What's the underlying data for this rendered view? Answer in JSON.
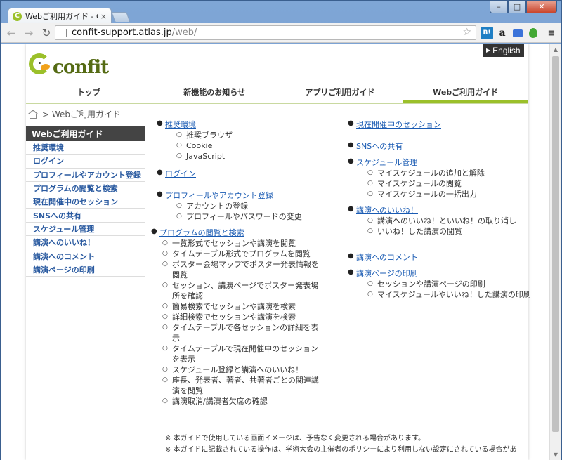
{
  "browser": {
    "tab_title": "Webご利用ガイド - Conf",
    "tab_favicon": "C",
    "tab_close": "×",
    "url_host": "confit-support.atlas.jp",
    "url_path": "/web/",
    "ext_hatena": "B!",
    "ext_amazon": "a",
    "window_min": "–",
    "window_max": "□",
    "window_close": "✕"
  },
  "header": {
    "english_label": "English",
    "logo_text": "confit"
  },
  "nav": {
    "items": [
      "トップ",
      "新機能のお知らせ",
      "アプリご利用ガイド",
      "Webご利用ガイド"
    ]
  },
  "breadcrumb": {
    "separator": ">",
    "current": "Webご利用ガイド"
  },
  "sidebar": {
    "title": "Webご利用ガイド",
    "items": [
      "推奨環境",
      "ログイン",
      "プロフィールやアカウント登録",
      "プログラムの閲覧と検索",
      "現在開催中のセッション",
      "SNSへの共有",
      "スケジュール管理",
      "講演へのいいね！",
      "講演へのコメント",
      "講演ページの印刷"
    ]
  },
  "content": {
    "col1": [
      {
        "title": "推奨環境",
        "items": [
          "推奨ブラウザ",
          "Cookie",
          "JavaScript"
        ]
      },
      {
        "title": "ログイン",
        "items": []
      },
      {
        "title": "プロフィールやアカウント登録",
        "items": [
          "アカウントの登録",
          "プロフィールやパスワードの変更"
        ]
      },
      {
        "title": "プログラムの閲覧と検索",
        "items": [
          "一覧形式でセッションや講演を閲覧",
          "タイムテーブル形式でプログラムを閲覧",
          "ポスター会場マップでポスター発表情報を閲覧",
          "セッション、講演ページでポスター発表場所を確認",
          "簡易検索でセッションや講演を検索",
          "詳細検索でセッションや講演を検索",
          "タイムテーブルで各セッションの詳細を表示",
          "タイムテーブルで現在開催中のセッションを表示",
          "スケジュール登録と講演へのいいね！",
          "座長、発表者、著者、共著者ごとの関連講演を閲覧",
          "講演取消/講演者欠席の確認"
        ]
      }
    ],
    "col2": [
      {
        "title": "現在開催中のセッション",
        "items": []
      },
      {
        "title": "SNSへの共有",
        "items": []
      },
      {
        "title": "スケジュール管理",
        "items": [
          "マイスケジュールの追加と解除",
          "マイスケジュールの閲覧",
          "マイスケジュールの一括出力"
        ]
      },
      {
        "title": "講演へのいいね！",
        "items": [
          "講演へのいいね！といいね！の取り消し",
          "いいね！した講演の閲覧"
        ]
      },
      {
        "title": "講演へのコメント",
        "items": []
      },
      {
        "title": "講演ページの印刷",
        "items": [
          "セッションや講演ページの印刷",
          "マイスケジュールやいいね！した講演の印刷"
        ]
      }
    ]
  },
  "notes": [
    "※ 本ガイドで使用している画面イメージは、予告なく変更される場合があります。",
    "※ 本ガイドに記載されている操作は、学術大会の主催者のポリシーにより利用しない設定にされている場合があ"
  ]
}
